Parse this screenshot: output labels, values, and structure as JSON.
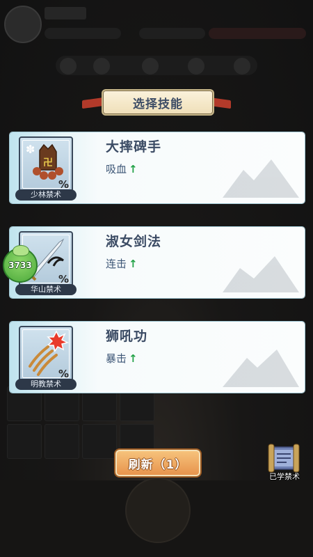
{
  "title": "选择技能",
  "cards": [
    {
      "name": "大摔碑手",
      "stat": "吸血",
      "arrow": "↑",
      "school": "少林禁术",
      "pct": "%"
    },
    {
      "name": "淑女剑法",
      "stat": "连击",
      "arrow": "↑",
      "school": "华山禁术",
      "pct": "%"
    },
    {
      "name": "狮吼功",
      "stat": "暴击",
      "arrow": "↑",
      "school": "明教禁术",
      "pct": "%"
    }
  ],
  "badge_value": "3733",
  "refresh_label": "刷新（1）",
  "learned_label": "已学禁术",
  "colors": {
    "title_text": "#3e4d66",
    "arrow_green": "#23a247",
    "refresh_orange": "#e6914a"
  },
  "icons": {
    "card1": "palm-beads-icon",
    "card2": "sword-icon",
    "card3": "claw-icon",
    "learned": "scroll-icon"
  }
}
